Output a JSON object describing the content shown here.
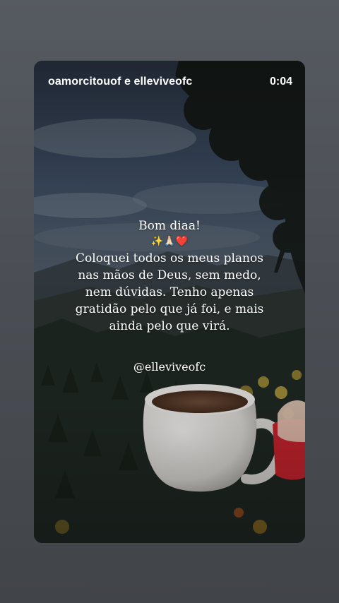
{
  "header": {
    "usernames": "oamorcitouof e elleviveofc",
    "timer": "0:04"
  },
  "story": {
    "greeting": "Bom diaa!",
    "emojis": "✨🙏🏻❤️",
    "message": "Coloquei todos os meus planos nas mãos de Deus, sem medo, nem dúvidas. Tenho apenas gratidão pelo que já foi, e mais ainda pelo que virá.",
    "handle": "@elleviveofc"
  },
  "background": {
    "description_icon": "forest-coffee-cup-photo",
    "sky_color": "#3b4a5e",
    "forest_color": "#1f2a22",
    "cup_color": "#e6e4e1",
    "accent_color": "#c4232d"
  }
}
